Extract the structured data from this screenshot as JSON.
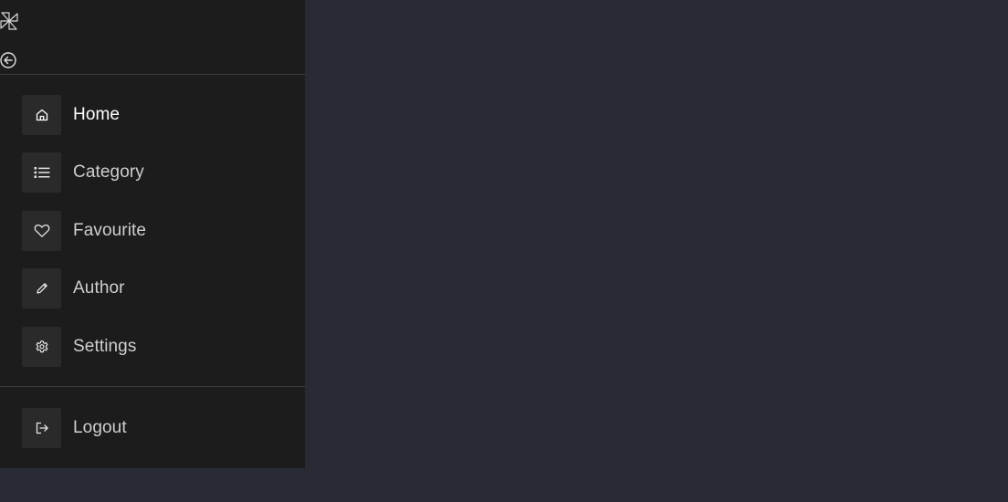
{
  "sidebar": {
    "brand_icon": "pinwheel-logo",
    "collapse_icon": "arrow-left-circle-icon",
    "items": [
      {
        "label": "Home",
        "icon": "home-icon",
        "active": true
      },
      {
        "label": "Category",
        "icon": "list-icon",
        "active": false
      },
      {
        "label": "Favourite",
        "icon": "heart-icon",
        "active": false
      },
      {
        "label": "Author",
        "icon": "pencil-icon",
        "active": false
      },
      {
        "label": "Settings",
        "icon": "gear-icon",
        "active": false
      }
    ],
    "footer": {
      "logout_label": "Logout",
      "logout_icon": "logout-icon"
    }
  },
  "colors": {
    "sidebar_bg": "#1c1c1c",
    "page_bg": "#282b34",
    "icon_box_bg": "#2a2a2a",
    "text_active": "#ffffff",
    "text": "#cfcfcf"
  }
}
